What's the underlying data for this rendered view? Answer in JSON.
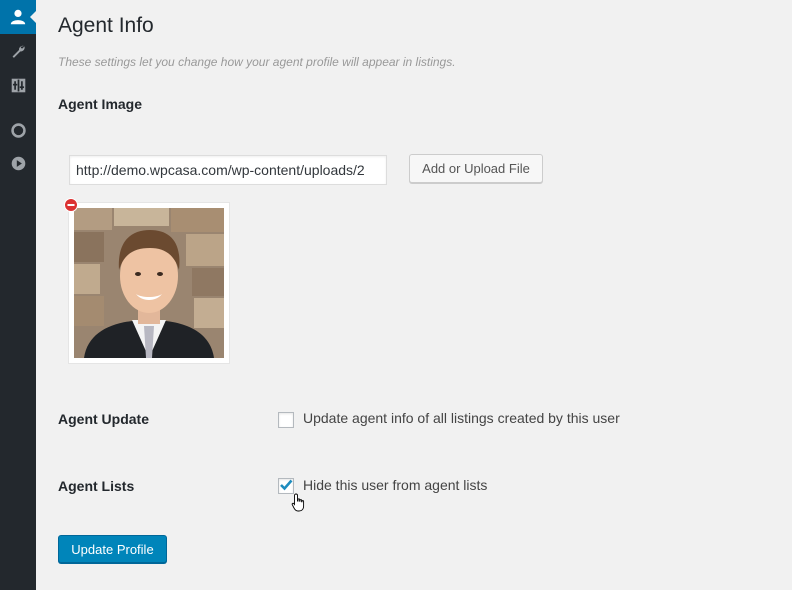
{
  "sidebar": {
    "items": [
      {
        "icon": "user-icon",
        "active": true
      },
      {
        "icon": "wrench-icon",
        "active": false
      },
      {
        "icon": "settings-grid-icon",
        "active": false
      },
      {
        "icon": "circle-icon",
        "active": false
      },
      {
        "icon": "play-icon",
        "active": false
      }
    ]
  },
  "page": {
    "title": "Agent Info",
    "description": "These settings let you change how your agent profile will appear in listings."
  },
  "agent_image": {
    "label": "Agent Image",
    "url_value": "http://demo.wpcasa.com/wp-content/uploads/2",
    "upload_button": "Add or Upload File"
  },
  "agent_update": {
    "label": "Agent Update",
    "checkbox_label": "Update agent info of all listings created by this user",
    "checked": false
  },
  "agent_lists": {
    "label": "Agent Lists",
    "checkbox_label": "Hide this user from agent lists",
    "checked": true
  },
  "submit": {
    "label": "Update Profile"
  },
  "colors": {
    "sidebar": "#23282d",
    "accent": "#0073aa",
    "primary_button": "#0085ba",
    "remove": "#dc3232"
  }
}
